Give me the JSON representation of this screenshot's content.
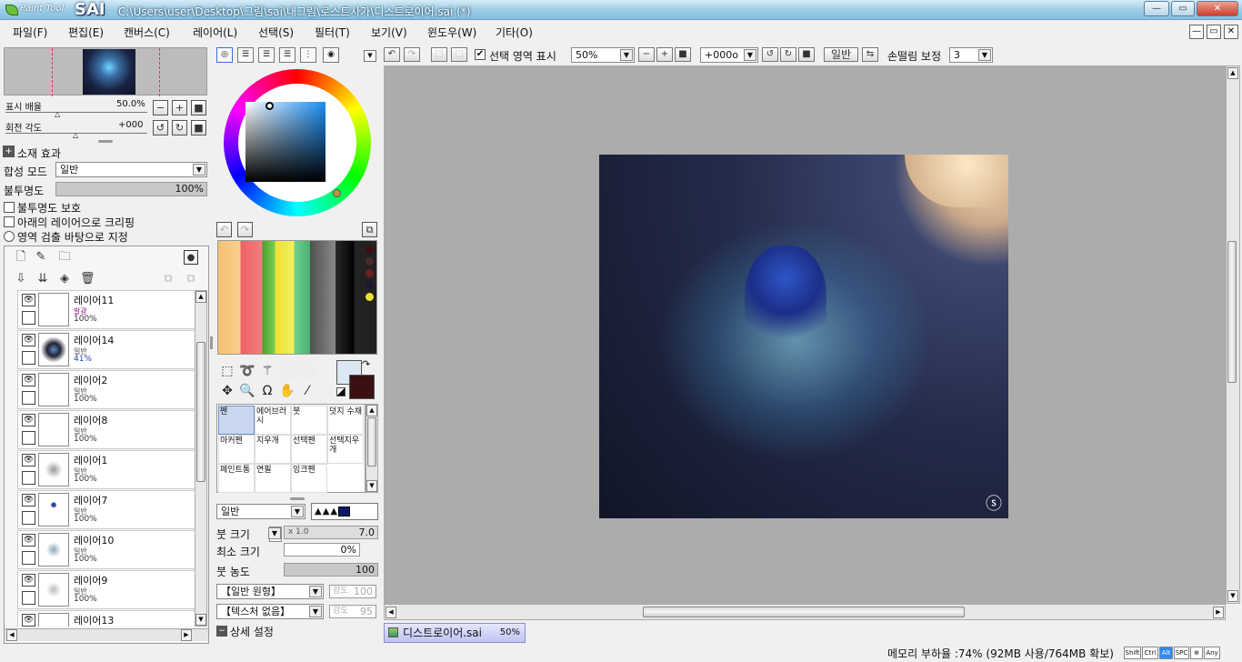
{
  "window": {
    "app_logo": "PaintTool SAI",
    "logo_small": "Paint Tool",
    "logo_big": "SAI",
    "title": "C:\\Users\\user\\Desktop\\그림\\sai\\내그림\\로스트사가\\디스트로이어.sai (*)",
    "min": "—",
    "max": "▭",
    "close": "✕"
  },
  "menu": [
    "파일(F)",
    "편집(E)",
    "캔버스(C)",
    "레이어(L)",
    "선택(S)",
    "필터(T)",
    "보기(V)",
    "윈도우(W)",
    "기타(O)"
  ],
  "mdi": [
    "—",
    "▭",
    "✕"
  ],
  "navigator": {
    "zoom_label": "표시 배율",
    "zoom_value": "50.0%",
    "rotate_label": "회전 각도",
    "rotate_value": "+000"
  },
  "layer_props": {
    "effect_label": "소재 효과",
    "blend_label": "합성 모드",
    "blend_value": "일반",
    "opacity_label": "불투명도",
    "opacity_value": "100%",
    "opacity": 1.0,
    "protect_opacity": "불투명도 보호",
    "clip_lower": "아래의 레이어으로 크리핑",
    "selection_source": "영역 검출 바탕으로 지정"
  },
  "layers": [
    {
      "name": "레이어11",
      "mode": "발광",
      "opacity": "100%"
    },
    {
      "name": "레이어14",
      "mode": "일반",
      "opacity": "41%"
    },
    {
      "name": "레이어2",
      "mode": "일반",
      "opacity": "100%"
    },
    {
      "name": "레이어8",
      "mode": "일반",
      "opacity": "100%"
    },
    {
      "name": "레이어1",
      "mode": "일반",
      "opacity": "100%"
    },
    {
      "name": "레이어7",
      "mode": "일반",
      "opacity": "100%"
    },
    {
      "name": "레이어10",
      "mode": "일반",
      "opacity": "100%"
    },
    {
      "name": "레이어9",
      "mode": "일반",
      "opacity": "100%"
    },
    {
      "name": "레이어13",
      "mode": "",
      "opacity": ""
    }
  ],
  "colors": {
    "accent": "#1a8ff5",
    "foreground": "#dbe8f4",
    "background": "#3a1010"
  },
  "brushes": [
    {
      "label": "펜"
    },
    {
      "label": "에어브러시"
    },
    {
      "label": "붓"
    },
    {
      "label": "덧지 수채"
    },
    {
      "label": "마커펜"
    },
    {
      "label": "지우개"
    },
    {
      "label": "선택펜"
    },
    {
      "label": "선택지우개"
    },
    {
      "label": "페인트통"
    },
    {
      "label": "연필"
    },
    {
      "label": "잉크펜"
    }
  ],
  "brush_settings": {
    "blend": "일반",
    "size_label": "붓 크기",
    "size_mult": "x 1.0",
    "size_value": "7.0",
    "min_size_label": "최소 크기",
    "min_size_value": "0%",
    "density_label": "붓 농도",
    "density_value": "100",
    "shape": "【일반 원형】",
    "shape_strength_label": "강도",
    "shape_strength": "100",
    "texture": "【텍스처 없음】",
    "texture_strength_label": "강도",
    "texture_strength": "95",
    "detail_label": "상세 설정"
  },
  "canvas_toolbar": {
    "show_selection": "선택 영역 표시",
    "zoom": "50%",
    "rotation": "+000o",
    "mode": "일반",
    "stabilizer_label": "손떨림 보정",
    "stabilizer_value": "3"
  },
  "status": {
    "doc_name": "디스트로이어.sai",
    "doc_zoom": "50%",
    "memory": "메모리 부하율 :74% (92MB 사용/764MB 확보)",
    "keys": [
      "Shift",
      "Ctrl",
      "Alt",
      "SPC",
      "⊕",
      "Any"
    ]
  }
}
